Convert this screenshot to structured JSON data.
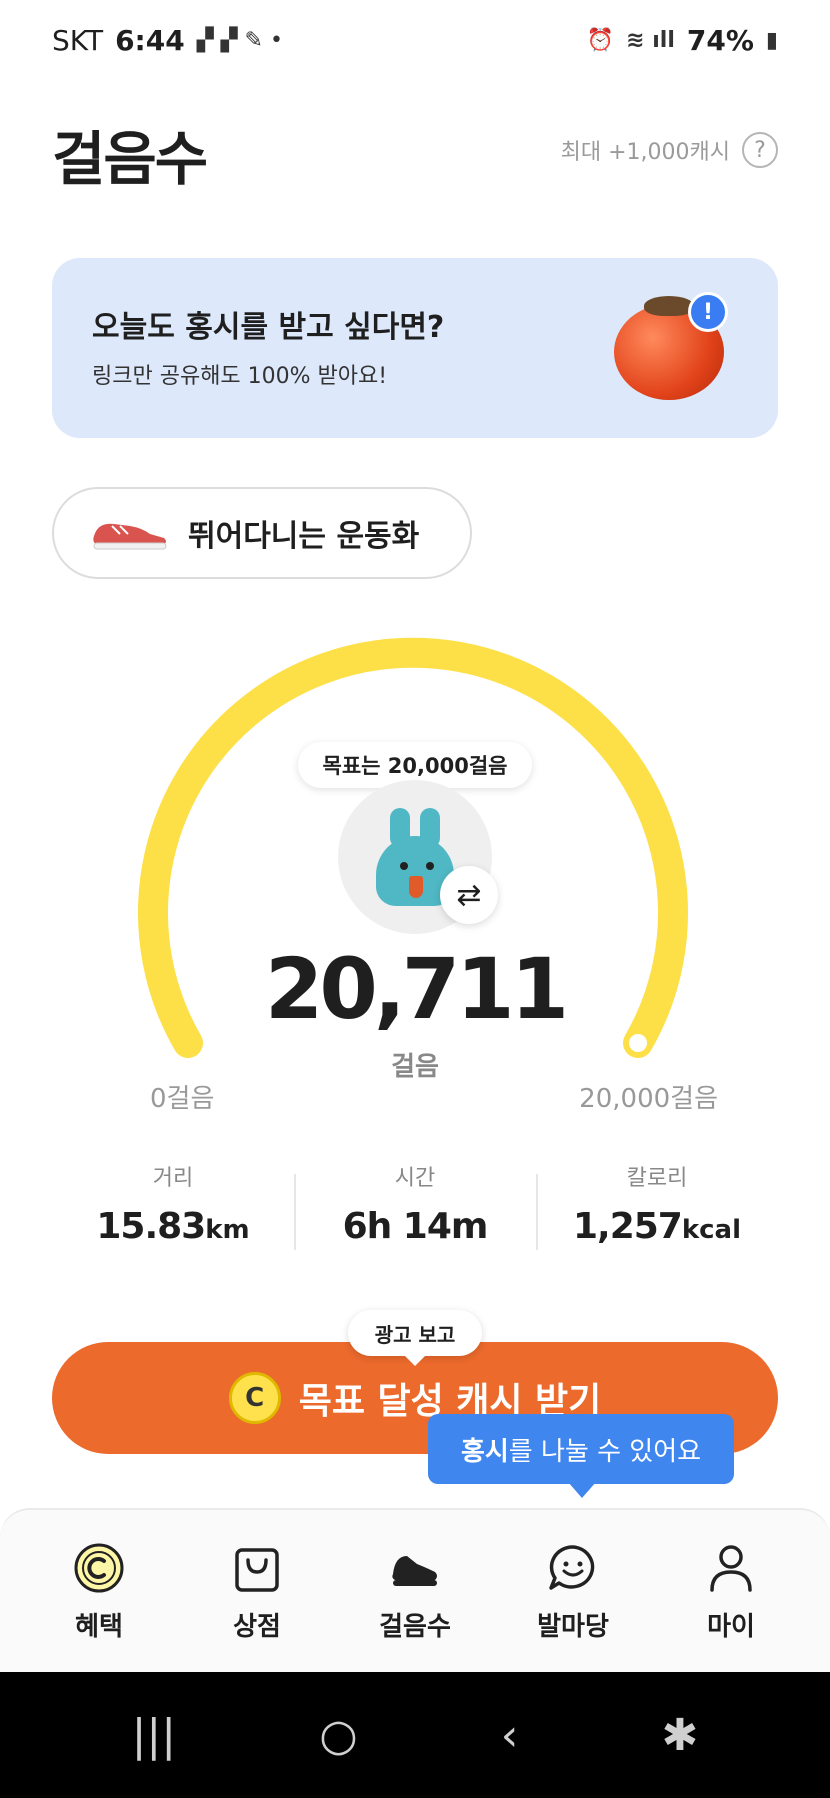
{
  "status": {
    "carrier": "SKT",
    "time": "6:44",
    "battery": "74%"
  },
  "header": {
    "title": "걸음수",
    "max_cash": "최대 +1,000캐시",
    "help": "?"
  },
  "banner": {
    "title": "오늘도 홍시를 받고 싶다면?",
    "subtitle": "링크만 공유해도 100% 받아요!",
    "badge": "!"
  },
  "shoe": {
    "label": "뛰어다니는 운동화"
  },
  "gauge": {
    "goal_label": "목표는 20,000걸음",
    "steps": "20,711",
    "unit": "걸음",
    "min_label": "0걸음",
    "max_label": "20,000걸음",
    "progress": 1.0,
    "color": "#fde047"
  },
  "stats": [
    {
      "label": "거리",
      "value": "15.83",
      "unit": "km"
    },
    {
      "label": "시간",
      "value": "6h 14m",
      "unit": ""
    },
    {
      "label": "칼로리",
      "value": "1,257",
      "unit": "kcal"
    }
  ],
  "cta": {
    "ad_label": "광고 보고",
    "label": "목표 달성 캐시 받기",
    "coin": "C",
    "color": "#ec6a2c"
  },
  "tooltip": {
    "bold": "홍시",
    "text": "를 나눌 수 있어요"
  },
  "nav": [
    {
      "label": "혜택",
      "icon": "cash-coin-icon"
    },
    {
      "label": "상점",
      "icon": "shopping-bag-icon"
    },
    {
      "label": "걸음수",
      "icon": "sneaker-icon"
    },
    {
      "label": "발마당",
      "icon": "chat-smile-icon"
    },
    {
      "label": "마이",
      "icon": "person-icon"
    }
  ],
  "system_nav": {
    "recents": "|||",
    "home": "○",
    "back": "‹"
  }
}
